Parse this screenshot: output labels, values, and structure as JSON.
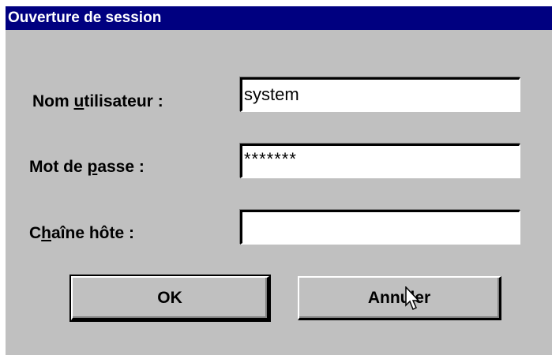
{
  "window": {
    "title": "Ouverture de session"
  },
  "fields": {
    "username": {
      "label_before": "Nom ",
      "label_mnemonic": "u",
      "label_after": "tilisateur :",
      "value": "system"
    },
    "password": {
      "label_before": "Mot de ",
      "label_mnemonic": "p",
      "label_after": "asse :",
      "value": "*******"
    },
    "host": {
      "label_before": "C",
      "label_mnemonic": "h",
      "label_after": "aîne hôte :",
      "value": ""
    }
  },
  "buttons": {
    "ok_label": "OK",
    "cancel_label": "Annuler"
  },
  "icons": {
    "cursor": "mouse-pointer-icon"
  },
  "colors": {
    "titlebar": "#000080",
    "dialog_face": "#c0c0c0"
  }
}
